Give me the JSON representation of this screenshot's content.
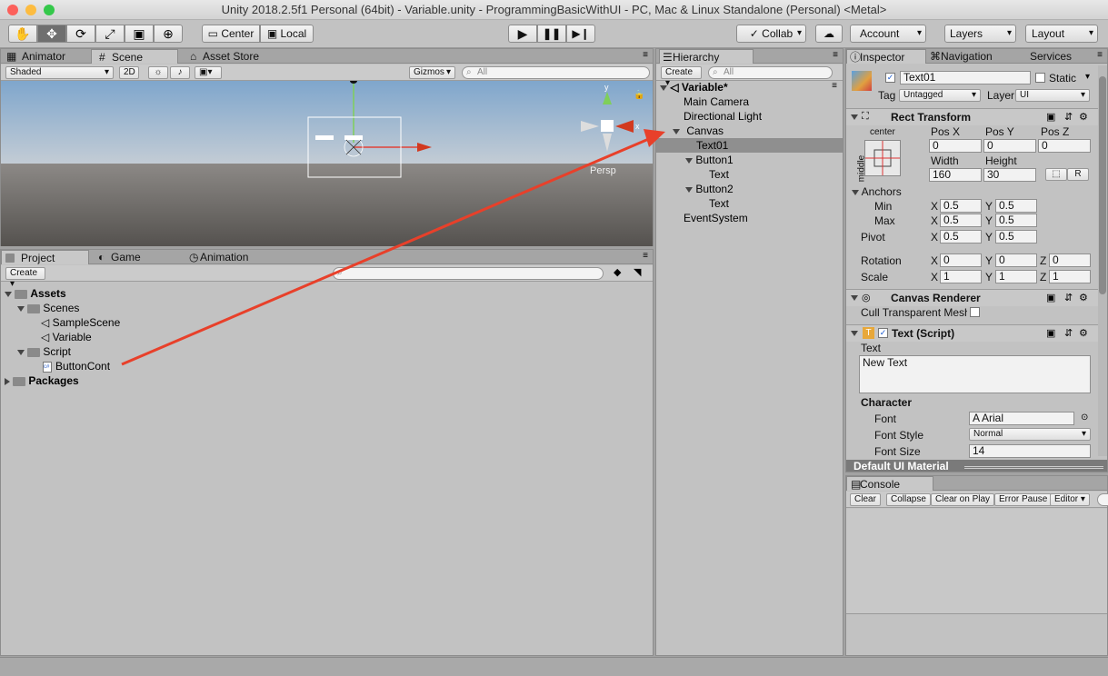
{
  "window": {
    "title": "Unity 2018.2.5f1 Personal (64bit) - Variable.unity - ProgrammingBasicWithUI - PC, Mac & Linux Standalone (Personal) <Metal>"
  },
  "toolbar": {
    "center": "Center",
    "local": "Local",
    "collab": "Collab",
    "account": "Account",
    "layers": "Layers",
    "layout": "Layout"
  },
  "scene_tabs": {
    "animator": "Animator",
    "scene": "Scene",
    "asset_store": "Asset Store"
  },
  "scene_bar": {
    "shading": "Shaded",
    "mode2d": "2D",
    "gizmos": "Gizmos",
    "search": "All",
    "persp": "Persp"
  },
  "project_tabs": {
    "project": "Project",
    "game": "Game",
    "animation": "Animation"
  },
  "project": {
    "create": "Create",
    "tree": [
      "Assets",
      "Scenes",
      "SampleScene",
      "Variable",
      "Script",
      "ButtonCont",
      "Packages"
    ]
  },
  "hierarchy": {
    "tab": "Hierarchy",
    "create": "Create",
    "search": "All",
    "scene": "Variable*",
    "items": [
      "Main Camera",
      "Directional Light",
      "Canvas",
      "Text01",
      "Button1",
      "Text",
      "Button2",
      "Text",
      "EventSystem"
    ]
  },
  "inspector": {
    "tabs": [
      "Inspector",
      "Navigation",
      "Services"
    ],
    "name": "Text01",
    "static": "Static",
    "tag_label": "Tag",
    "tag": "Untagged",
    "layer_label": "Layer",
    "layer": "UI",
    "rect": {
      "title": "Rect Transform",
      "center": "center",
      "middle": "middle",
      "posx_l": "Pos X",
      "posy_l": "Pos Y",
      "posz_l": "Pos Z",
      "posx": "0",
      "posy": "0",
      "posz": "0",
      "width_l": "Width",
      "height_l": "Height",
      "width": "160",
      "height": "30",
      "r": "R",
      "anchors": "Anchors",
      "min": "Min",
      "max": "Max",
      "pivot": "Pivot",
      "rotation": "Rotation",
      "scale": "Scale",
      "minx": "0.5",
      "miny": "0.5",
      "maxx": "0.5",
      "maxy": "0.5",
      "pivx": "0.5",
      "pivy": "0.5",
      "rotx": "0",
      "roty": "0",
      "rotz": "0",
      "scx": "1",
      "scy": "1",
      "scz": "1",
      "X": "X",
      "Y": "Y",
      "Z": "Z"
    },
    "canvas_renderer": {
      "title": "Canvas Renderer",
      "cull": "Cull Transparent Mesh"
    },
    "text": {
      "title": "Text (Script)",
      "text_label": "Text",
      "text_value": "New Text",
      "character": "Character",
      "font_l": "Font",
      "font": "Arial",
      "style_l": "Font Style",
      "style": "Normal",
      "size_l": "Font Size",
      "size": "14"
    },
    "material": "Default UI Material"
  },
  "console": {
    "tab": "Console",
    "clear": "Clear",
    "collapse": "Collapse",
    "clear_on_play": "Clear on Play",
    "error_pause": "Error Pause",
    "editor": "Editor"
  },
  "colors": {
    "arrow": "#e8402a",
    "accent_selected": "#8f8f8f"
  }
}
